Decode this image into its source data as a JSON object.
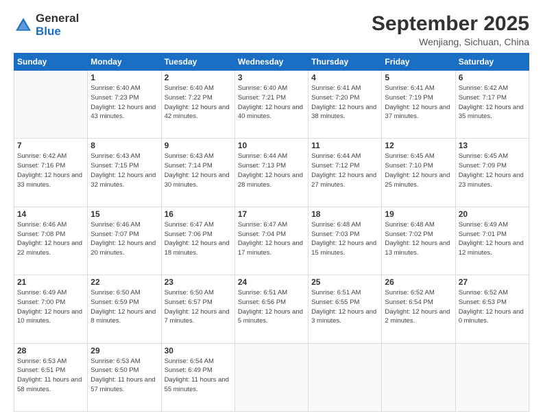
{
  "logo": {
    "general": "General",
    "blue": "Blue"
  },
  "header": {
    "month": "September 2025",
    "location": "Wenjiang, Sichuan, China"
  },
  "weekdays": [
    "Sunday",
    "Monday",
    "Tuesday",
    "Wednesday",
    "Thursday",
    "Friday",
    "Saturday"
  ],
  "weeks": [
    [
      {
        "day": "",
        "sunrise": "",
        "sunset": "",
        "daylight": ""
      },
      {
        "day": "1",
        "sunrise": "6:40 AM",
        "sunset": "7:23 PM",
        "daylight": "12 hours and 43 minutes."
      },
      {
        "day": "2",
        "sunrise": "6:40 AM",
        "sunset": "7:22 PM",
        "daylight": "12 hours and 42 minutes."
      },
      {
        "day": "3",
        "sunrise": "6:40 AM",
        "sunset": "7:21 PM",
        "daylight": "12 hours and 40 minutes."
      },
      {
        "day": "4",
        "sunrise": "6:41 AM",
        "sunset": "7:20 PM",
        "daylight": "12 hours and 38 minutes."
      },
      {
        "day": "5",
        "sunrise": "6:41 AM",
        "sunset": "7:19 PM",
        "daylight": "12 hours and 37 minutes."
      },
      {
        "day": "6",
        "sunrise": "6:42 AM",
        "sunset": "7:17 PM",
        "daylight": "12 hours and 35 minutes."
      }
    ],
    [
      {
        "day": "7",
        "sunrise": "6:42 AM",
        "sunset": "7:16 PM",
        "daylight": "12 hours and 33 minutes."
      },
      {
        "day": "8",
        "sunrise": "6:43 AM",
        "sunset": "7:15 PM",
        "daylight": "12 hours and 32 minutes."
      },
      {
        "day": "9",
        "sunrise": "6:43 AM",
        "sunset": "7:14 PM",
        "daylight": "12 hours and 30 minutes."
      },
      {
        "day": "10",
        "sunrise": "6:44 AM",
        "sunset": "7:13 PM",
        "daylight": "12 hours and 28 minutes."
      },
      {
        "day": "11",
        "sunrise": "6:44 AM",
        "sunset": "7:12 PM",
        "daylight": "12 hours and 27 minutes."
      },
      {
        "day": "12",
        "sunrise": "6:45 AM",
        "sunset": "7:10 PM",
        "daylight": "12 hours and 25 minutes."
      },
      {
        "day": "13",
        "sunrise": "6:45 AM",
        "sunset": "7:09 PM",
        "daylight": "12 hours and 23 minutes."
      }
    ],
    [
      {
        "day": "14",
        "sunrise": "6:46 AM",
        "sunset": "7:08 PM",
        "daylight": "12 hours and 22 minutes."
      },
      {
        "day": "15",
        "sunrise": "6:46 AM",
        "sunset": "7:07 PM",
        "daylight": "12 hours and 20 minutes."
      },
      {
        "day": "16",
        "sunrise": "6:47 AM",
        "sunset": "7:06 PM",
        "daylight": "12 hours and 18 minutes."
      },
      {
        "day": "17",
        "sunrise": "6:47 AM",
        "sunset": "7:04 PM",
        "daylight": "12 hours and 17 minutes."
      },
      {
        "day": "18",
        "sunrise": "6:48 AM",
        "sunset": "7:03 PM",
        "daylight": "12 hours and 15 minutes."
      },
      {
        "day": "19",
        "sunrise": "6:48 AM",
        "sunset": "7:02 PM",
        "daylight": "12 hours and 13 minutes."
      },
      {
        "day": "20",
        "sunrise": "6:49 AM",
        "sunset": "7:01 PM",
        "daylight": "12 hours and 12 minutes."
      }
    ],
    [
      {
        "day": "21",
        "sunrise": "6:49 AM",
        "sunset": "7:00 PM",
        "daylight": "12 hours and 10 minutes."
      },
      {
        "day": "22",
        "sunrise": "6:50 AM",
        "sunset": "6:59 PM",
        "daylight": "12 hours and 8 minutes."
      },
      {
        "day": "23",
        "sunrise": "6:50 AM",
        "sunset": "6:57 PM",
        "daylight": "12 hours and 7 minutes."
      },
      {
        "day": "24",
        "sunrise": "6:51 AM",
        "sunset": "6:56 PM",
        "daylight": "12 hours and 5 minutes."
      },
      {
        "day": "25",
        "sunrise": "6:51 AM",
        "sunset": "6:55 PM",
        "daylight": "12 hours and 3 minutes."
      },
      {
        "day": "26",
        "sunrise": "6:52 AM",
        "sunset": "6:54 PM",
        "daylight": "12 hours and 2 minutes."
      },
      {
        "day": "27",
        "sunrise": "6:52 AM",
        "sunset": "6:53 PM",
        "daylight": "12 hours and 0 minutes."
      }
    ],
    [
      {
        "day": "28",
        "sunrise": "6:53 AM",
        "sunset": "6:51 PM",
        "daylight": "11 hours and 58 minutes."
      },
      {
        "day": "29",
        "sunrise": "6:53 AM",
        "sunset": "6:50 PM",
        "daylight": "11 hours and 57 minutes."
      },
      {
        "day": "30",
        "sunrise": "6:54 AM",
        "sunset": "6:49 PM",
        "daylight": "11 hours and 55 minutes."
      },
      {
        "day": "",
        "sunrise": "",
        "sunset": "",
        "daylight": ""
      },
      {
        "day": "",
        "sunrise": "",
        "sunset": "",
        "daylight": ""
      },
      {
        "day": "",
        "sunrise": "",
        "sunset": "",
        "daylight": ""
      },
      {
        "day": "",
        "sunrise": "",
        "sunset": "",
        "daylight": ""
      }
    ]
  ]
}
